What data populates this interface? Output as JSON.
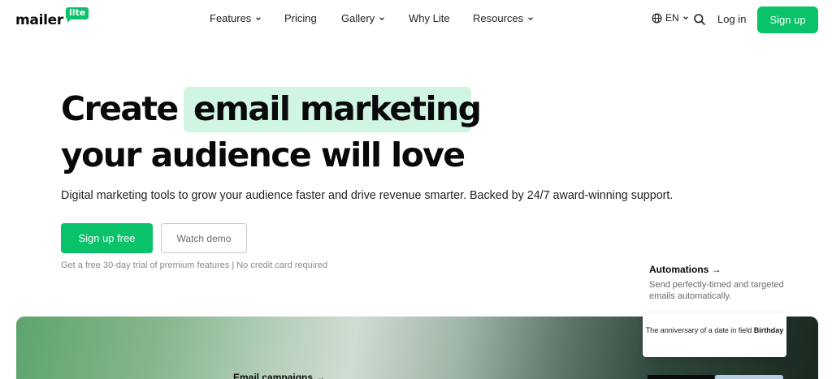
{
  "brand": {
    "name": "mailer",
    "badge": "lite"
  },
  "nav": {
    "items": [
      {
        "label": "Features",
        "dropdown": true
      },
      {
        "label": "Pricing",
        "dropdown": false
      },
      {
        "label": "Gallery",
        "dropdown": true
      },
      {
        "label": "Why Lite",
        "dropdown": false
      },
      {
        "label": "Resources",
        "dropdown": true
      }
    ],
    "language": "EN",
    "login": "Log in",
    "signup": "Sign up"
  },
  "hero": {
    "title_part1": "Create",
    "title_highlight": "email marketing",
    "title_line2": "your audience will love",
    "subtitle": "Digital marketing tools to grow your audience faster and drive revenue smarter. Backed by 24/7 award-winning support.",
    "cta_primary": "Sign up free",
    "cta_secondary": "Watch demo",
    "trial_note": "Get a free 30-day trial of premium features | No credit card required"
  },
  "automations": {
    "title": "Automations →",
    "description": "Send perfectly-timed and targeted emails automatically."
  },
  "showcase": {
    "card_text": "The anniversary of a date in field",
    "card_field": "Birthday",
    "email_campaigns": "Email campaigns →"
  },
  "colors": {
    "accent": "#09c269",
    "highlight": "#d1f5e3"
  },
  "icons": [
    "chevron-down-icon",
    "globe-icon",
    "search-icon"
  ]
}
